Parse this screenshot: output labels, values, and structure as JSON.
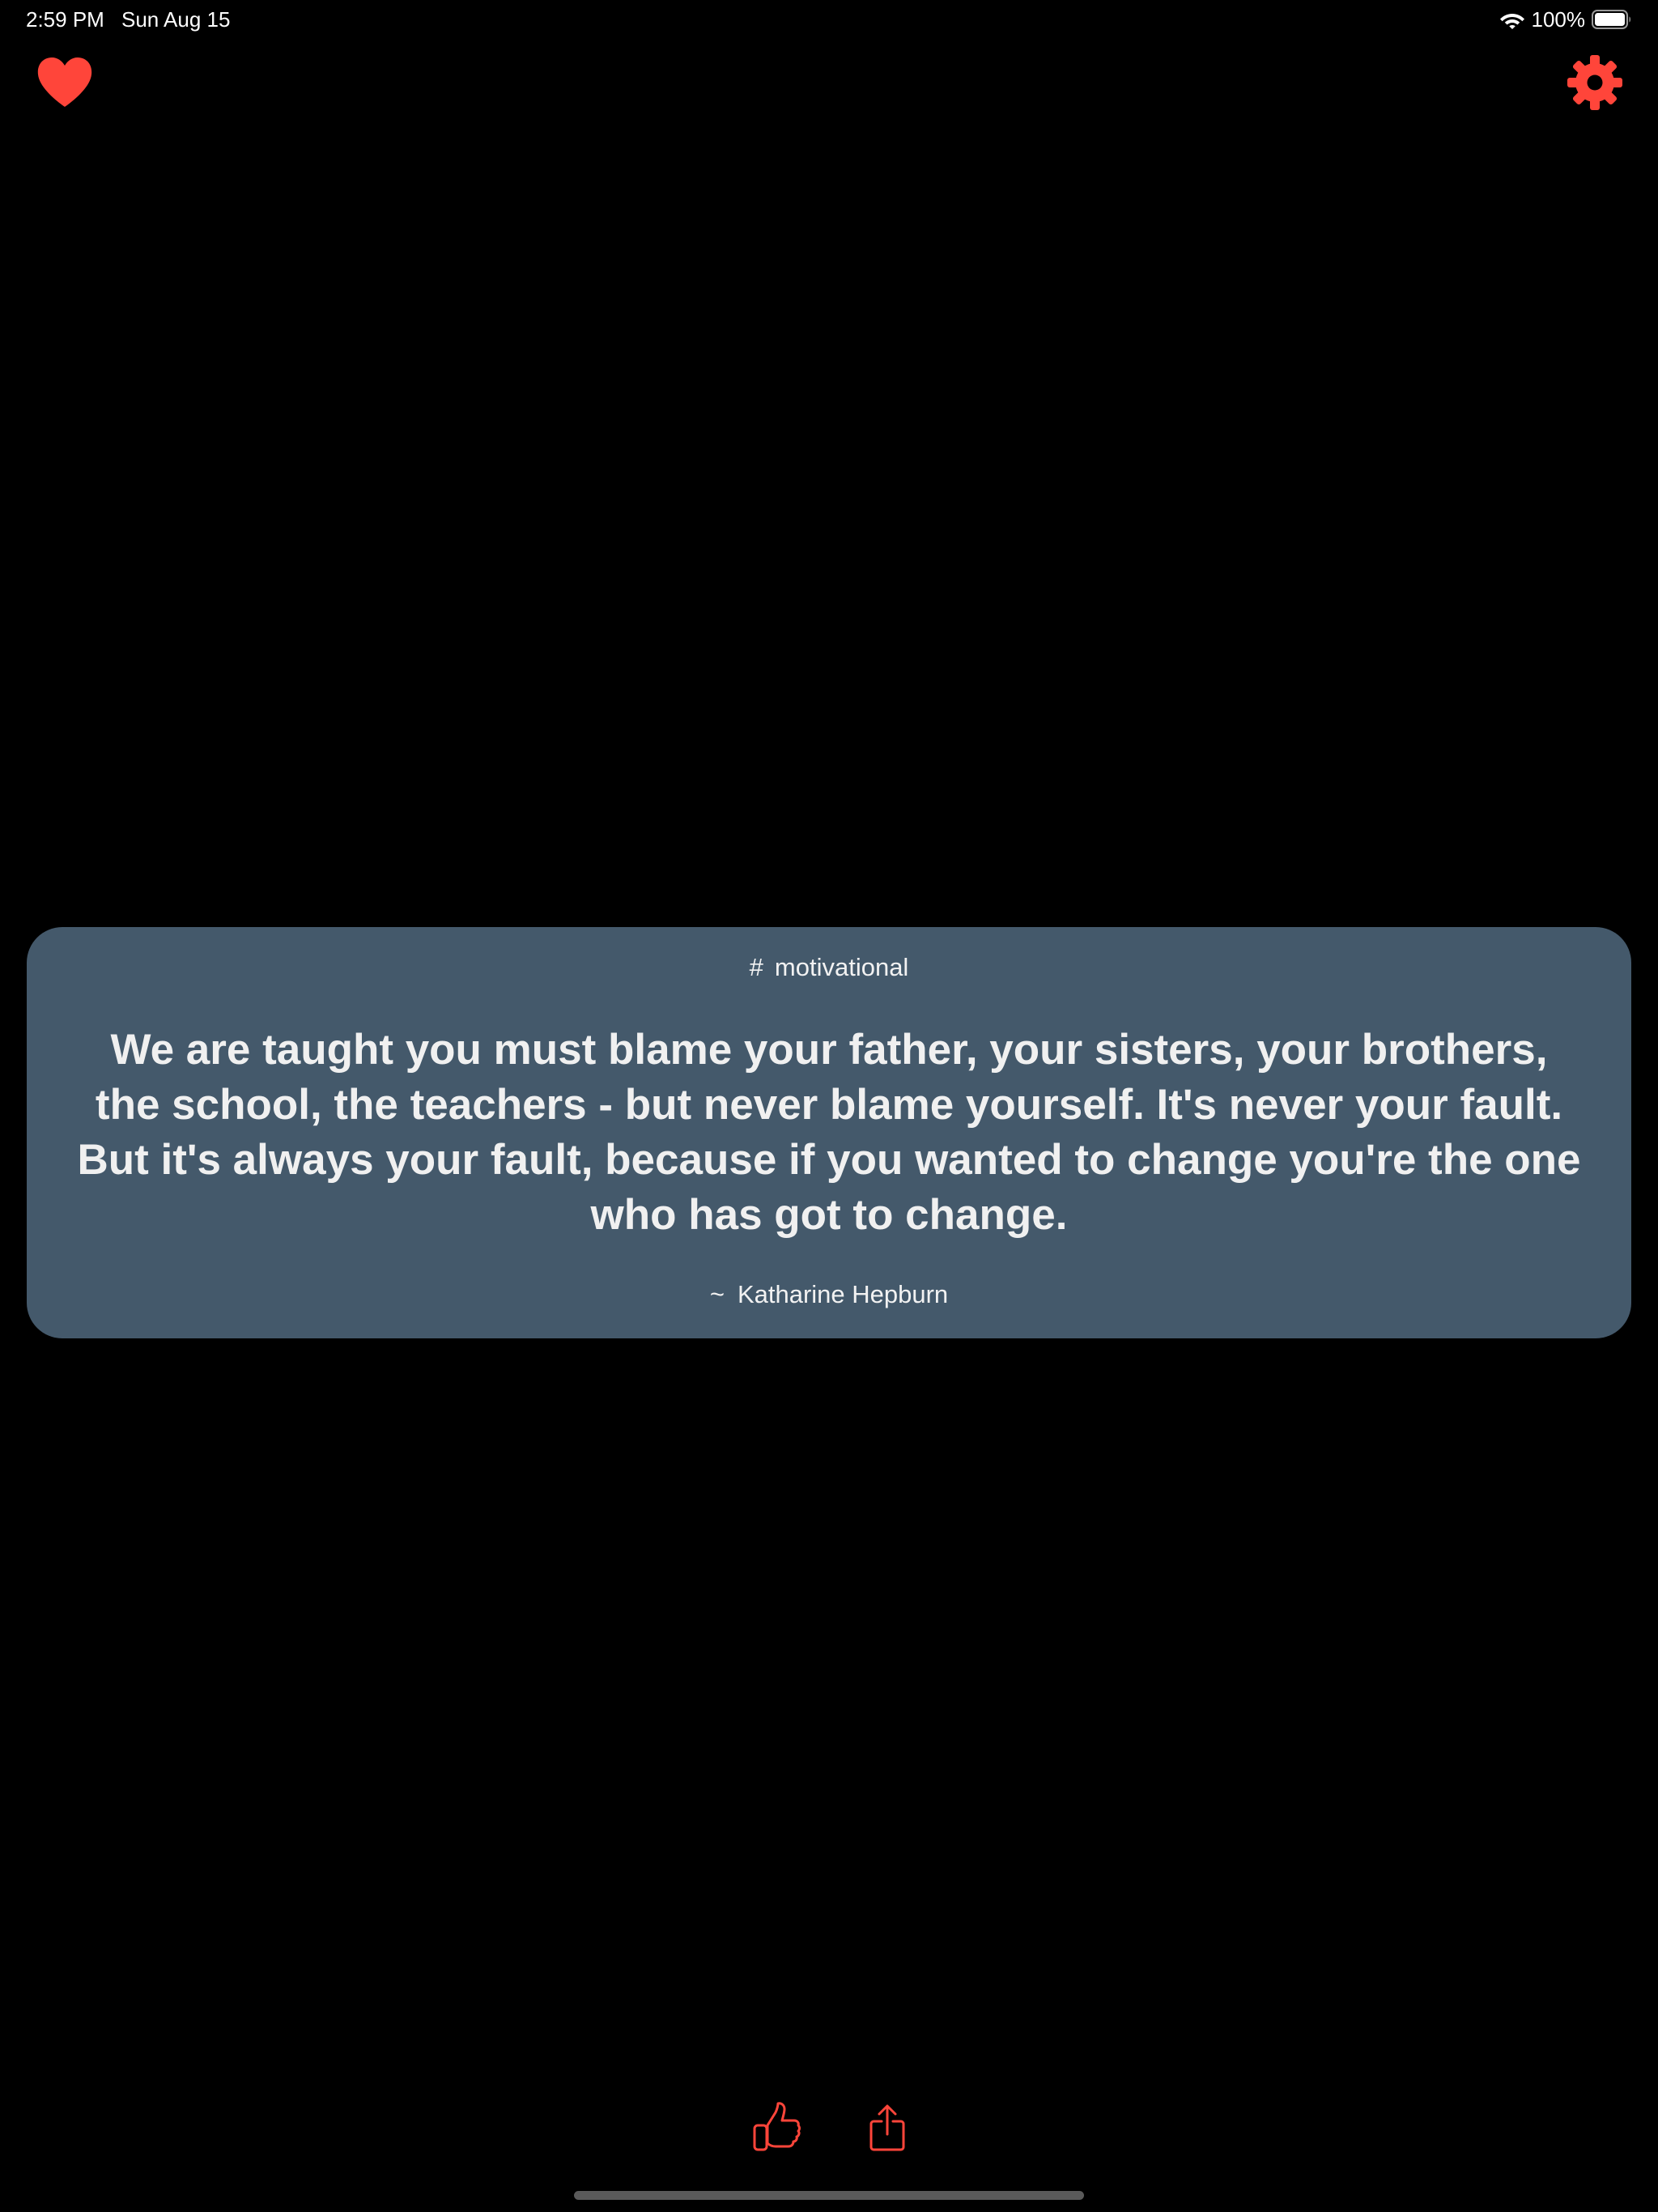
{
  "status_bar": {
    "time": "2:59 PM",
    "date": "Sun Aug 15",
    "battery_percent": "100%",
    "battery_level": 1.0
  },
  "colors": {
    "accent": "#ff453a",
    "card_background": "#44596b",
    "background": "#000000"
  },
  "icons": {
    "favorites": "heart-icon",
    "settings": "gear-icon",
    "like": "thumbs-up-icon",
    "share": "share-icon",
    "wifi": "wifi-icon",
    "battery": "battery-icon"
  },
  "quote": {
    "category_symbol": "#",
    "category": "motivational",
    "text": "We are taught you must blame your father, your sisters, your brothers, the school, the teachers - but never blame yourself. It's never your fault. But it's always your fault, because if you wanted to change you're the one who has got to change.",
    "author_prefix": "~",
    "author": "Katharine Hepburn"
  }
}
